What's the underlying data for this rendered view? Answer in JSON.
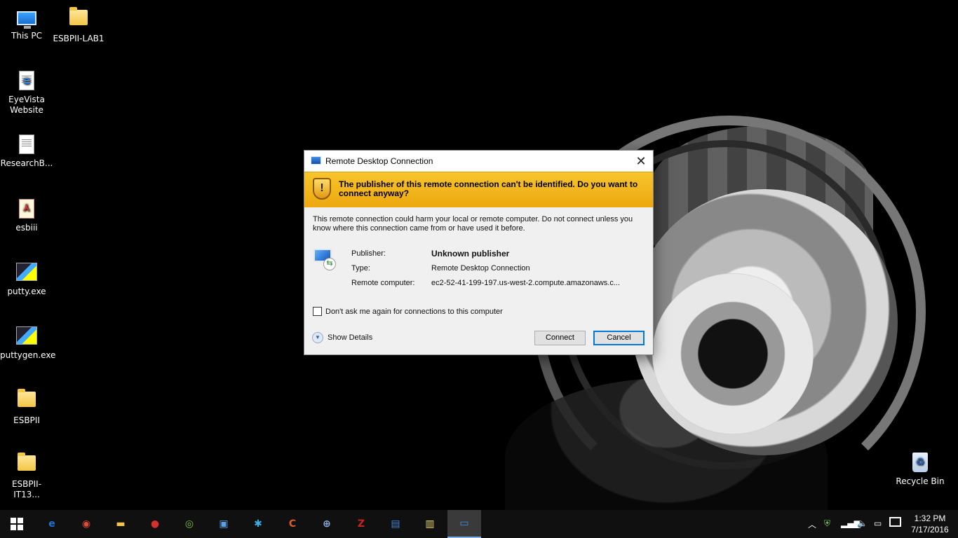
{
  "desktop": {
    "icons": [
      {
        "label": "This PC",
        "icon": "computer-icon"
      },
      {
        "label": "ESBPII-LAB1",
        "icon": "folder-icon"
      },
      {
        "label": "EyeVista Website",
        "icon": "edge-shortcut-icon"
      },
      {
        "label": "ResearchB...",
        "icon": "document-icon"
      },
      {
        "label": "esbiii",
        "icon": "pdf-icon"
      },
      {
        "label": "putty.exe",
        "icon": "putty-icon"
      },
      {
        "label": "puttygen.exe",
        "icon": "puttygen-icon"
      },
      {
        "label": "ESBPII",
        "icon": "folder-icon"
      },
      {
        "label": "ESBPII-IT13...",
        "icon": "folder-icon"
      },
      {
        "label": "Recycle Bin",
        "icon": "recycle-bin-icon"
      }
    ]
  },
  "dialog": {
    "title": "Remote Desktop Connection",
    "close_glyph": "✕",
    "banner": {
      "icon": "warning-shield-icon",
      "shield_glyph": "!",
      "message": "The publisher of this remote connection can't be identified. Do you want to connect anyway?"
    },
    "warning_text": "This remote connection could harm your local or remote computer. Do not connect unless you know where this connection came from or have used it before.",
    "details": {
      "publisher_label": "Publisher:",
      "publisher_value": "Unknown publisher",
      "type_label": "Type:",
      "type_value": "Remote Desktop Connection",
      "remote_label": "Remote computer:",
      "remote_value": "ec2-52-41-199-197.us-west-2.compute.amazonaws.c..."
    },
    "dont_ask_label": "Don't ask me again for connections to this computer",
    "dont_ask_checked": false,
    "show_details_label": "Show Details",
    "connect_label": "Connect",
    "cancel_label": "Cancel"
  },
  "taskbar": {
    "items": [
      {
        "name": "start",
        "icon": "windows-logo-icon"
      },
      {
        "name": "edge",
        "icon": "edge-icon",
        "glyph": "e",
        "color": "#1b74d6"
      },
      {
        "name": "chrome",
        "icon": "chrome-icon",
        "glyph": "◉",
        "color": "#dd4b39"
      },
      {
        "name": "file-explorer",
        "icon": "file-explorer-icon",
        "glyph": "▬",
        "color": "#f3c645"
      },
      {
        "name": "app-red",
        "icon": "red-disc-icon",
        "glyph": "●",
        "color": "#d43030"
      },
      {
        "name": "android-studio",
        "icon": "android-studio-icon",
        "glyph": "◎",
        "color": "#7bbf3a"
      },
      {
        "name": "app-square",
        "icon": "square-app-icon",
        "glyph": "▣",
        "color": "#5aa0e6"
      },
      {
        "name": "app-blue-gear",
        "icon": "blue-gear-icon",
        "glyph": "✱",
        "color": "#3ab0e6"
      },
      {
        "name": "ccleaner",
        "icon": "ccleaner-icon",
        "glyph": "C",
        "color": "#e05a2a"
      },
      {
        "name": "network-app",
        "icon": "network-globe-icon",
        "glyph": "⊕",
        "color": "#8fb0e0"
      },
      {
        "name": "filezilla",
        "icon": "filezilla-icon",
        "glyph": "Z",
        "color": "#c8241f"
      },
      {
        "name": "app-windows",
        "icon": "windows-app-icon",
        "glyph": "▤",
        "color": "#3f84d6"
      },
      {
        "name": "folder-app",
        "icon": "folder-window-icon",
        "glyph": "▥",
        "color": "#e9d87a"
      },
      {
        "name": "remote-desktop",
        "icon": "remote-desktop-icon",
        "glyph": "▭",
        "color": "#3f8fe6",
        "active": true
      }
    ],
    "tray": {
      "chevron_glyph": "︿",
      "clock_time": "1:32 PM",
      "clock_date": "7/17/2016"
    }
  }
}
